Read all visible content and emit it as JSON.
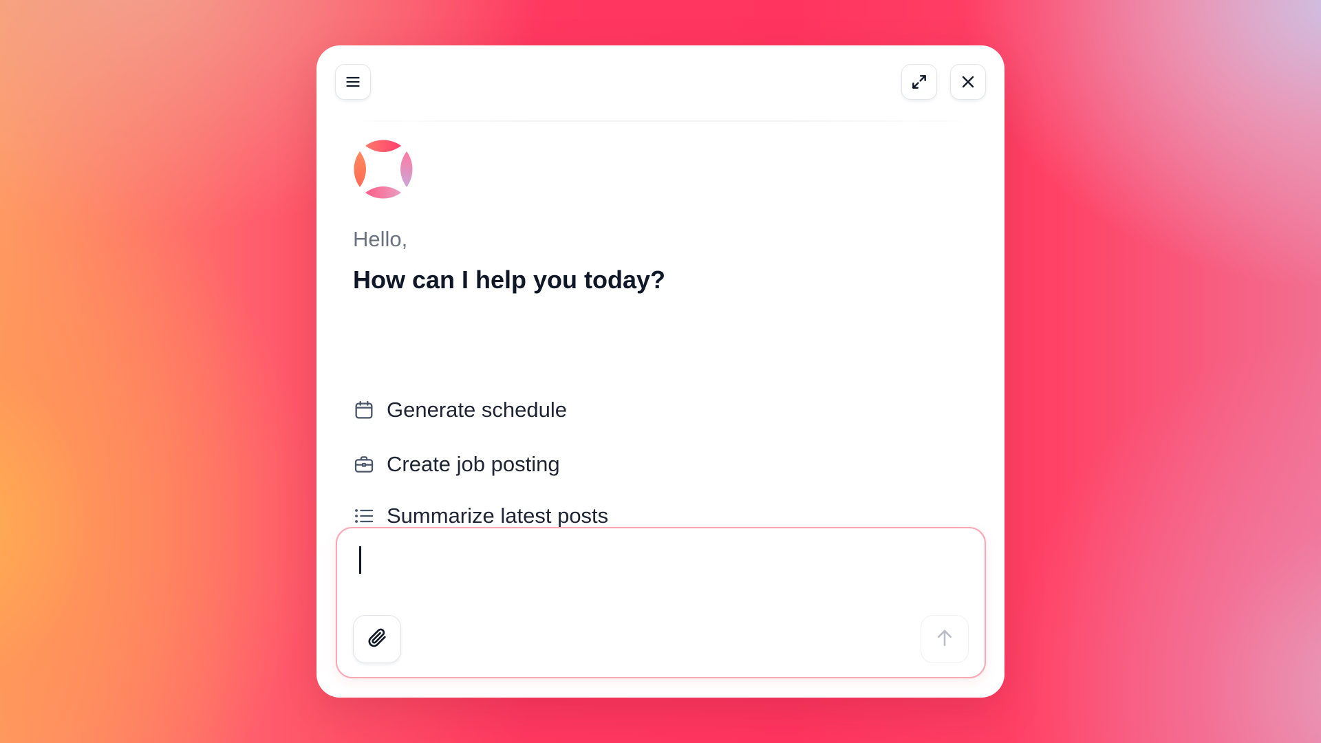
{
  "window": {
    "menu_icon": "hamburger-menu-icon",
    "expand_icon": "expand-arrows-icon",
    "close_icon": "close-x-icon"
  },
  "assistant": {
    "logo": "four-petal-gradient-logo",
    "greeting": "Hello,",
    "headline": "How can I help you today?"
  },
  "suggestions": [
    {
      "label": "Generate schedule",
      "icon": "calendar-icon"
    },
    {
      "label": "Create job posting",
      "icon": "briefcase-icon"
    },
    {
      "label": "Summarize latest posts",
      "icon": "list-icon"
    }
  ],
  "composer": {
    "value": "",
    "placeholder": "",
    "attach_icon": "paperclip-icon",
    "send_icon": "arrow-up-icon"
  },
  "colors": {
    "headline": "#101828",
    "greeting": "#6b7280",
    "composer_border": "#f7a9b6",
    "logo_orange": "#ff9a5a",
    "logo_pink": "#ff4d7a",
    "logo_lilac": "#c9a6d8"
  }
}
